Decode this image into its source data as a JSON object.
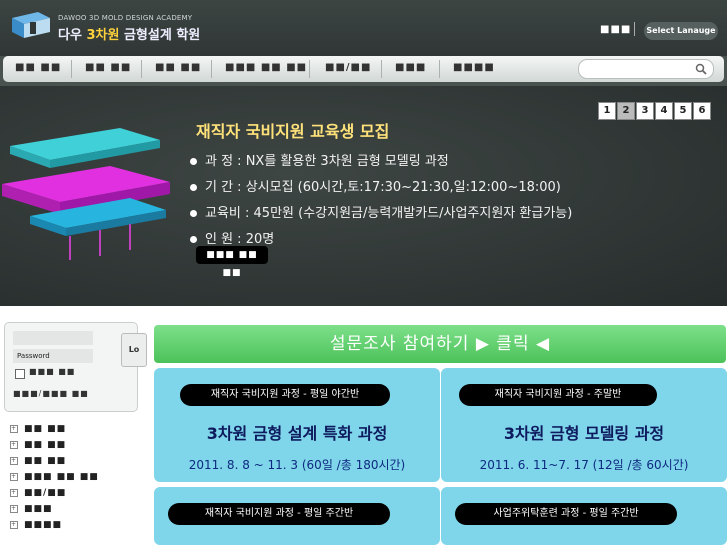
{
  "header": {
    "logo_small": "DAWOO 3D MOLD DESIGN ACADEMY",
    "logo_main_prefix": "다우",
    "logo_main_accent": "3차원",
    "logo_main_suffix": "금형설계 학원",
    "top_links": "■■■",
    "lang_button": "Select Lanauge"
  },
  "nav": {
    "items": [
      "■■ ■■",
      "■■ ■■",
      "■■ ■■",
      "■■■ ■■ ■■",
      "■■/■■",
      "■■■",
      "■■■■"
    ],
    "search_placeholder": ""
  },
  "banner": {
    "pages": [
      "1",
      "2",
      "3",
      "4",
      "5",
      "6"
    ],
    "active_page": "2",
    "title": "재직자 국비지원 교육생 모집",
    "lines": [
      "과  정 : NX를 활용한 3차원 금형 모델링 과정",
      "기  간 : 상시모집 (60시간,토:17:30~21:30,일:12:00~18:00)",
      "교육비 : 45만원 (수강지원금/능력개발카드/사업주지원자 환급가능)",
      "인  원 : 20명"
    ],
    "more_button": "■■■ ■■ ■■"
  },
  "login": {
    "id_placeholder": "",
    "password_label": "Password",
    "login_button": "Lo",
    "remember": "■■■ ■■",
    "links": "■■■/■■■ ■■"
  },
  "sidebar": {
    "items": [
      "■■ ■■",
      "■■ ■■",
      "■■ ■■",
      "■■■ ■■ ■■",
      "■■/■■",
      "■■■",
      "■■■■"
    ]
  },
  "survey": {
    "label": "설문조사 참여하기 ▶ 클릭 ◀"
  },
  "cards": [
    {
      "badge": "재직자 국비지원 과정 - 평일 야간반",
      "title": "3차원 금형 설계 특화 과정",
      "date": "2011. 8. 8 ~ 11. 3 (60일 /총 180시간)"
    },
    {
      "badge": "재직자 국비지원 과정 - 주말반",
      "title": "3차원 금형 모델링 과정",
      "date": "2011. 6. 11~7. 17 (12일 /총 60시간)"
    },
    {
      "badge": "재직자 국비지원 과정 - 평일 주간반",
      "title": "",
      "date": ""
    },
    {
      "badge": "사업주위탁훈련 과정 - 평일 주간반",
      "title": "",
      "date": ""
    }
  ]
}
